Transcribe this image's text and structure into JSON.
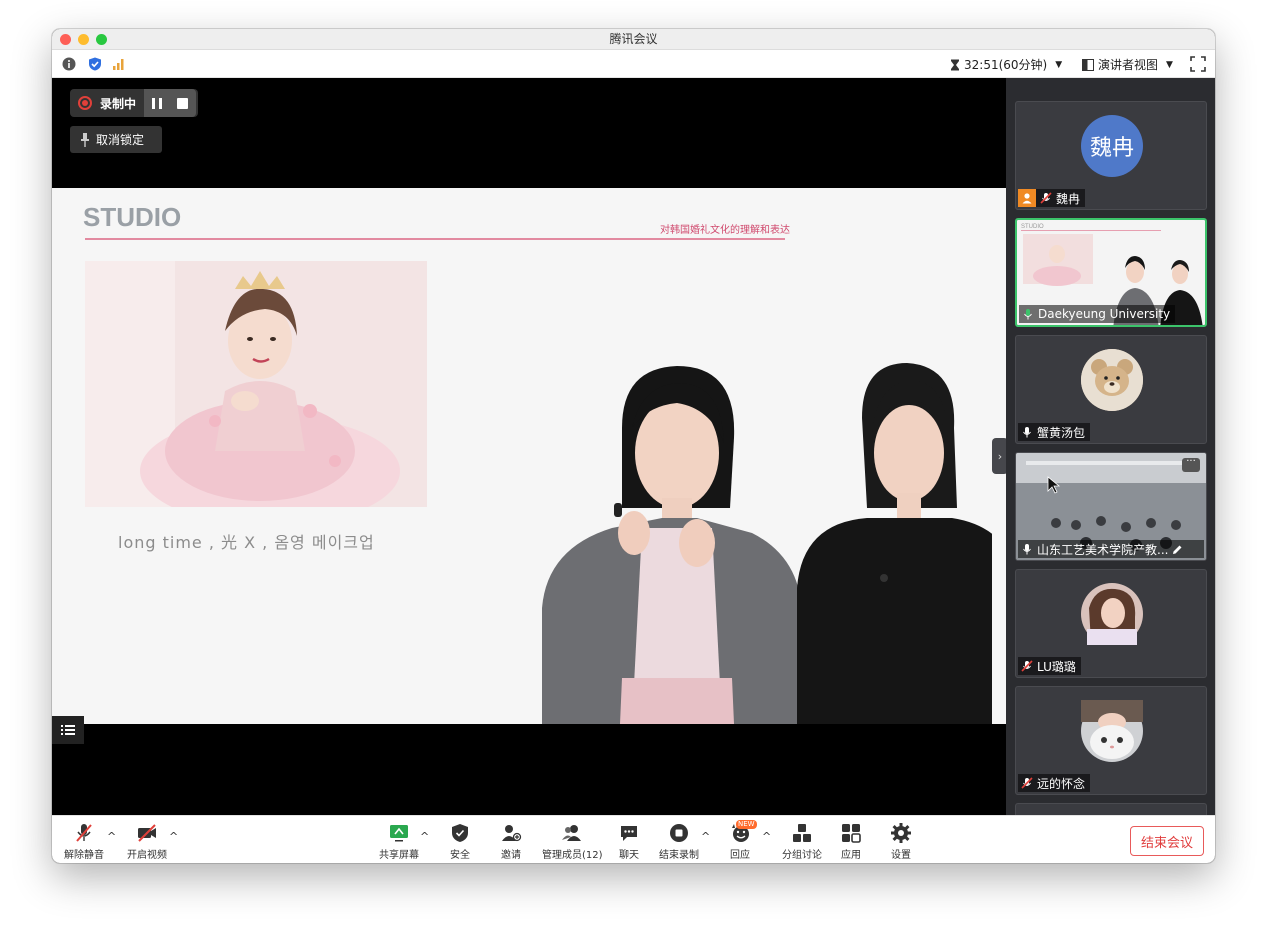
{
  "window": {
    "title": "腾讯会议"
  },
  "infobar": {
    "timer": "32:51(60分钟)",
    "view_mode": "演讲者视图"
  },
  "recording": {
    "label": "录制中"
  },
  "unlock": {
    "label": "取消锁定"
  },
  "slide": {
    "heading": "STUDIO",
    "subtitle": "对韩国婚礼文化的理解和表达",
    "caption": "long time , 光  X , 옴영 메이크업"
  },
  "participants": [
    {
      "name": "魏冉",
      "avatar_text": "魏冉",
      "muted": true,
      "host": true
    },
    {
      "name": "Daekyeung University",
      "muted": false,
      "speaking": true
    },
    {
      "name": "蟹黄汤包",
      "muted": false
    },
    {
      "name": "山东工艺美术学院产教...",
      "muted": false
    },
    {
      "name": "LU璐璐",
      "muted": true
    },
    {
      "name": "远的怀念",
      "muted": true
    }
  ],
  "toolbar": {
    "unmute": "解除静音",
    "start_video": "开启视频",
    "share_screen": "共享屏幕",
    "security": "安全",
    "invite": "邀请",
    "manage_members": "管理成员(12)",
    "chat": "聊天",
    "end_recording": "结束录制",
    "reactions": "回应",
    "reactions_badge": "NEW",
    "breakout": "分组讨论",
    "apps": "应用",
    "settings": "设置",
    "end_meeting": "结束会议"
  },
  "colors": {
    "accent_green": "#3cc46b",
    "record_red": "#e0403a",
    "end_red": "#e03c3c",
    "avatar_blue": "#4f79c9",
    "host_orange": "#f08a24"
  }
}
